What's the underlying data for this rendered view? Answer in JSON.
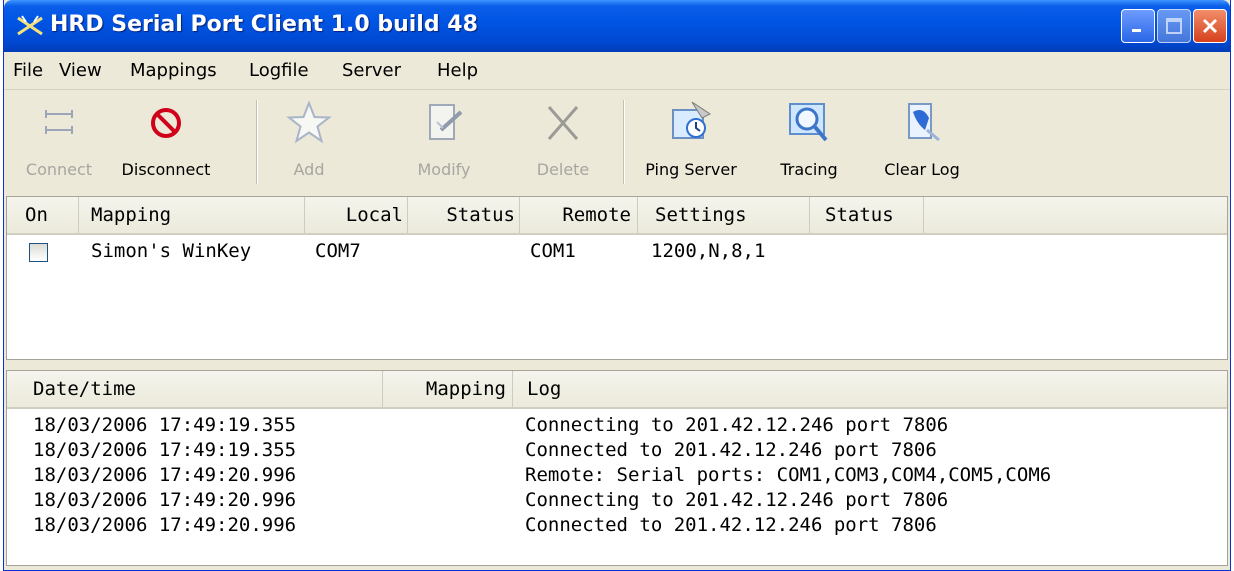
{
  "window": {
    "title": "HRD Serial Port Client 1.0 build 48",
    "accent_color": "#0055e5",
    "icons": [
      "antenna-icon",
      "minimize-icon",
      "maximize-icon",
      "close-icon"
    ]
  },
  "menu": {
    "items": [
      "File",
      "View",
      "Mappings",
      "Logfile",
      "Server",
      "Help"
    ]
  },
  "toolbar": {
    "buttons": [
      {
        "label": "Connect",
        "icon": "connect-arrows-icon",
        "enabled": false
      },
      {
        "label": "Disconnect",
        "icon": "no-entry-icon",
        "enabled": true
      },
      {
        "label": "Add",
        "icon": "star-icon",
        "enabled": false
      },
      {
        "label": "Modify",
        "icon": "edit-document-icon",
        "enabled": false
      },
      {
        "label": "Delete",
        "icon": "x-icon",
        "enabled": false
      },
      {
        "label": "Ping Server",
        "icon": "ping-clock-icon",
        "enabled": true
      },
      {
        "label": "Tracing",
        "icon": "magnifier-window-icon",
        "enabled": true
      },
      {
        "label": "Clear Log",
        "icon": "clear-document-icon",
        "enabled": true
      }
    ]
  },
  "mappings_table": {
    "columns": [
      "On",
      "Mapping",
      "Local",
      "Status",
      "Remote",
      "Settings",
      "Status"
    ],
    "rows": [
      {
        "on": false,
        "mapping": "Simon's WinKey",
        "local": "COM7",
        "local_status": "",
        "remote": "COM1",
        "settings": "1200,N,8,1",
        "remote_status": ""
      }
    ]
  },
  "log_table": {
    "columns": [
      "Date/time",
      "Mapping",
      "Log"
    ],
    "rows": [
      {
        "datetime": "18/03/2006 17:49:19.355",
        "mapping": "",
        "log": "Connecting to 201.42.12.246 port 7806"
      },
      {
        "datetime": "18/03/2006 17:49:19.355",
        "mapping": "",
        "log": "Connected to 201.42.12.246 port 7806"
      },
      {
        "datetime": "18/03/2006 17:49:20.996",
        "mapping": "",
        "log": "Remote: Serial ports: COM1,COM3,COM4,COM5,COM6"
      },
      {
        "datetime": "18/03/2006 17:49:20.996",
        "mapping": "",
        "log": "Connecting to 201.42.12.246 port 7806"
      },
      {
        "datetime": "18/03/2006 17:49:20.996",
        "mapping": "",
        "log": "Connected to 201.42.12.246 port 7806"
      }
    ]
  }
}
